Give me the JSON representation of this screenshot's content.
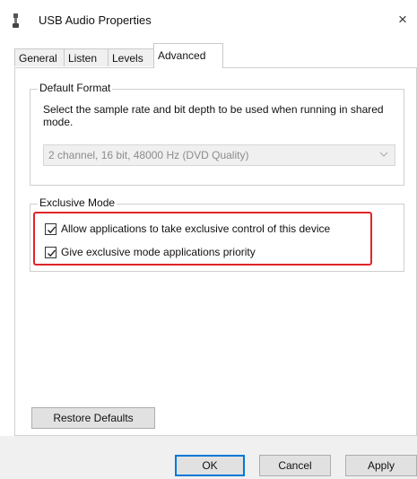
{
  "window": {
    "title": "USB Audio Properties",
    "close_glyph": "×",
    "icon": "speaker-icon"
  },
  "tabs": [
    {
      "label": "General",
      "active": false
    },
    {
      "label": "Listen",
      "active": false
    },
    {
      "label": "Levels",
      "active": false
    },
    {
      "label": "Advanced",
      "active": true
    }
  ],
  "default_format": {
    "legend": "Default Format",
    "description": "Select the sample rate and bit depth to be used when running in shared mode.",
    "select_value": "2 channel, 16 bit, 48000 Hz (DVD Quality)",
    "select_enabled": false
  },
  "exclusive_mode": {
    "legend": "Exclusive Mode",
    "options": [
      {
        "label": "Allow applications to take exclusive control of this device",
        "checked": true
      },
      {
        "label": "Give exclusive mode applications priority",
        "checked": true
      }
    ],
    "highlight_color": "#e0242a"
  },
  "buttons": {
    "restore_defaults": "Restore Defaults",
    "ok": "OK",
    "cancel": "Cancel",
    "apply": "Apply"
  },
  "colors": {
    "accent": "#0078d7",
    "disabled_text": "#8c8c8c"
  }
}
